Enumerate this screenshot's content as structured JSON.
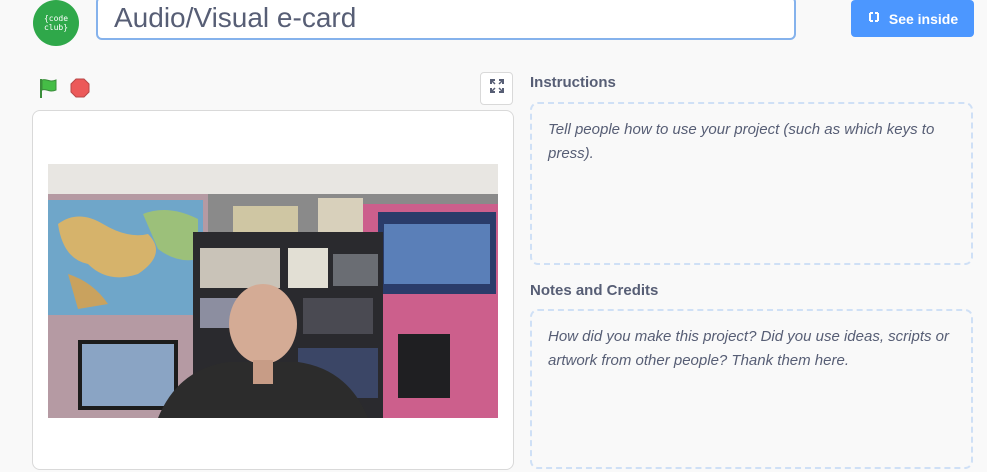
{
  "logo": {
    "line1": "{code",
    "line2": "club}"
  },
  "project": {
    "title": "Audio/Visual e-card"
  },
  "header": {
    "see_inside_label": "See inside"
  },
  "instructions": {
    "label": "Instructions",
    "placeholder": "Tell people how to use your project (such as which keys to press)."
  },
  "notes": {
    "label": "Notes and Credits",
    "placeholder": "How did you make this project? Did you use ideas, scripts or artwork from other people? Thank them here."
  },
  "colors": {
    "accent": "#4c97ff",
    "logo_green": "#2fa84a",
    "flag_green": "#45bd46",
    "stop_red": "#ec5959",
    "text": "#575e75"
  },
  "icons": {
    "see_inside": "remix-icon",
    "green_flag": "green-flag-icon",
    "stop": "stop-icon",
    "fullscreen": "fullscreen-icon"
  }
}
